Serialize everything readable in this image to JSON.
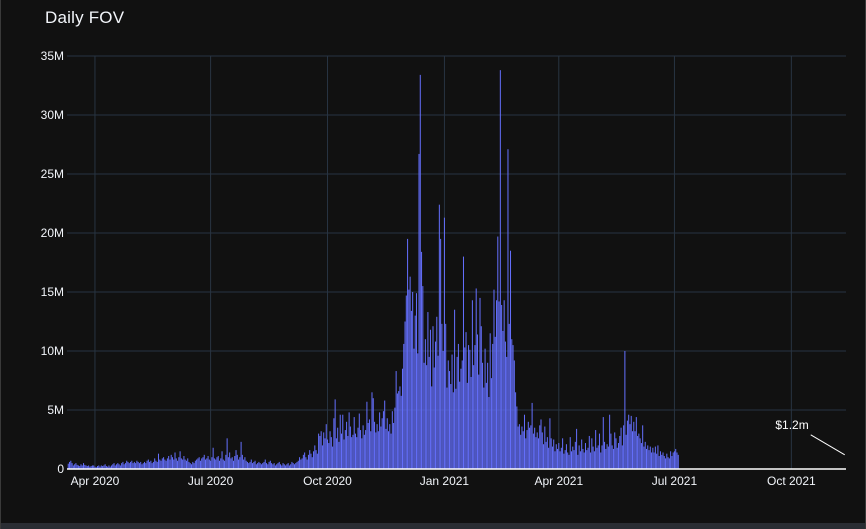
{
  "colors": {
    "background": "#111111",
    "grid": "#283442",
    "bar": "#636efa",
    "text": "#f2f5fa",
    "axis_line": "#ffffff"
  },
  "chart_data": {
    "type": "bar",
    "title": "Daily FOV",
    "xlabel": "",
    "ylabel": "",
    "grid": true,
    "x_range": [
      "2020-03-10",
      "2021-11-13"
    ],
    "ylim": [
      0,
      35000000
    ],
    "y_ticks": [
      0,
      5000000,
      10000000,
      15000000,
      20000000,
      25000000,
      30000000,
      35000000
    ],
    "y_tick_labels": [
      "0",
      "5M",
      "10M",
      "15M",
      "20M",
      "25M",
      "30M",
      "35M"
    ],
    "x_ticks": [
      "2020-04-01",
      "2020-07-01",
      "2020-10-01",
      "2021-01-01",
      "2021-04-01",
      "2021-07-01",
      "2021-10-01"
    ],
    "x_tick_labels": [
      "Apr 2020",
      "Jul 2020",
      "Oct 2020",
      "Jan 2021",
      "Apr 2021",
      "Jul 2021",
      "Oct 2021"
    ],
    "series": [
      {
        "color": "#636efa",
        "daily": true,
        "start_date": "2020-03-11",
        "values_m": [
          0.45,
          0.6,
          0.7,
          0.5,
          0.3,
          0.4,
          0.5,
          0.35,
          0.3,
          0.25,
          0.4,
          0.3,
          0.5,
          0.35,
          0.3,
          0.25,
          0.3,
          0.2,
          0.25,
          0.3,
          0.3,
          0.2,
          0.15,
          0.25,
          0.3,
          0.2,
          0.3,
          0.25,
          0.3,
          0.4,
          0.25,
          0.2,
          0.3,
          0.2,
          0.3,
          0.4,
          0.5,
          0.3,
          0.4,
          0.5,
          0.4,
          0.3,
          0.5,
          0.6,
          0.4,
          0.5,
          0.7,
          0.6,
          0.5,
          0.6,
          0.7,
          0.5,
          0.6,
          0.5,
          0.7,
          0.6,
          0.5,
          0.6,
          0.4,
          0.5,
          0.6,
          0.5,
          0.7,
          0.8,
          0.6,
          0.7,
          0.5,
          0.6,
          0.9,
          0.7,
          0.6,
          1.3,
          0.8,
          0.7,
          0.9,
          1.0,
          0.8,
          0.7,
          0.9,
          1.1,
          0.8,
          1.2,
          1.0,
          0.8,
          1.4,
          0.9,
          0.7,
          1.0,
          1.5,
          0.9,
          0.8,
          1.1,
          0.8,
          0.7,
          0.9,
          0.6,
          0.5,
          0.4,
          0.6,
          0.5,
          0.7,
          0.8,
          0.9,
          1.0,
          0.7,
          0.9,
          1.0,
          1.2,
          0.8,
          0.9,
          1.1,
          0.8,
          0.7,
          1.0,
          1.8,
          0.9,
          0.8,
          1.0,
          1.1,
          0.7,
          0.9,
          1.5,
          0.8,
          0.7,
          1.2,
          2.6,
          1.0,
          1.4,
          0.9,
          1.0,
          0.7,
          1.1,
          1.6,
          1.2,
          0.8,
          1.0,
          2.3,
          1.2,
          0.8,
          1.0,
          0.7,
          0.6,
          0.5,
          0.6,
          0.8,
          0.5,
          0.6,
          0.7,
          0.4,
          0.5,
          0.6,
          0.5,
          0.4,
          0.5,
          0.6,
          0.8,
          0.5,
          0.4,
          0.6,
          0.7,
          0.5,
          0.4,
          0.5,
          0.3,
          0.4,
          0.5,
          0.6,
          0.4,
          0.3,
          0.5,
          0.4,
          0.3,
          0.4,
          0.5,
          0.3,
          0.4,
          0.6,
          0.5,
          0.4,
          0.5,
          0.6,
          0.7,
          1.0,
          0.8,
          0.9,
          1.2,
          1.4,
          1.0,
          0.8,
          1.2,
          1.6,
          1.3,
          1.0,
          1.5,
          2.0,
          1.6,
          1.3,
          3.0,
          2.8,
          3.2,
          2.0,
          3.1,
          2.6,
          3.8,
          2.5,
          2.2,
          3.2,
          2.7,
          1.9,
          4.3,
          5.9,
          2.6,
          3.5,
          2.3,
          4.6,
          3.0,
          4.6,
          2.5,
          3.3,
          4.0,
          2.8,
          4.8,
          3.6,
          2.7,
          2.9,
          4.4,
          3.0,
          2.7,
          3.5,
          4.7,
          3.3,
          2.6,
          3.7,
          2.9,
          3.3,
          5.7,
          3.9,
          4.2,
          3.2,
          6.5,
          6.0,
          4.0,
          3.1,
          3.8,
          3.2,
          4.8,
          3.6,
          4.3,
          4.9,
          5.8,
          3.4,
          4.3,
          3.2,
          3.8,
          3.0,
          4.9,
          3.9,
          5.2,
          8.3,
          6.4,
          6.6,
          7.0,
          6.2,
          8.5,
          10.6,
          12.5,
          14.7,
          19.5,
          15.2,
          16.3,
          13.4,
          15.0,
          10.2,
          13.0,
          14.9,
          9.8,
          26.7,
          33.4,
          18.4,
          15.5,
          9.0,
          11.0,
          8.8,
          13.3,
          9.5,
          11.8,
          7.0,
          12.1,
          8.6,
          10.8,
          12.9,
          9.6,
          22.4,
          19.5,
          12.3,
          10.0,
          21.3,
          12.3,
          6.9,
          9.2,
          8.3,
          7.2,
          9.7,
          6.5,
          13.5,
          6.8,
          9.5,
          10.6,
          7.4,
          8.5,
          9.2,
          18.0,
          10.3,
          11.6,
          7.3,
          10.5,
          10.1,
          7.8,
          14.3,
          8.8,
          10.5,
          15.3,
          11.4,
          8.0,
          14.5,
          12.1,
          9.0,
          6.9,
          10.2,
          7.3,
          9.0,
          6.1,
          11.5,
          7.7,
          10.6,
          15.2,
          11.2,
          14.3,
          19.7,
          14.2,
          33.8,
          13.9,
          11.7,
          14.3,
          10.8,
          9.5,
          27.1,
          12.3,
          18.5,
          11.0,
          10.5,
          9.2,
          6.5,
          5.3,
          3.6,
          3.8,
          2.9,
          3.6,
          3.2,
          4.6,
          2.6,
          3.3,
          4.0,
          3.5,
          3.7,
          5.6,
          3.0,
          3.5,
          2.7,
          3.1,
          2.6,
          3.7,
          4.2,
          3.1,
          2.1,
          3.6,
          2.3,
          2.7,
          1.8,
          4.3,
          2.6,
          1.9,
          2.5,
          1.5,
          2.1,
          1.7,
          2.2,
          1.5,
          1.8,
          2.6,
          1.3,
          1.6,
          2.1,
          1.4,
          1.2,
          2.7,
          1.5,
          1.9,
          1.6,
          2.3,
          3.4,
          1.2,
          2.0,
          1.5,
          2.5,
          1.7,
          1.4,
          2.2,
          1.6,
          1.8,
          2.8,
          1.4,
          2.6,
          1.9,
          1.5,
          3.3,
          1.8,
          2.0,
          3.0,
          1.4,
          2.0,
          4.4,
          2.3,
          1.7,
          2.1,
          1.9,
          4.6,
          3.0,
          2.0,
          1.7,
          3.1,
          2.6,
          1.8,
          2.2,
          2.8,
          3.5,
          2.0,
          3.7,
          10.0,
          2.9,
          4.1,
          4.6,
          3.8,
          4.5,
          3.2,
          4.0,
          3.2,
          4.4,
          2.8,
          3.0,
          2.6,
          2.2,
          3.7,
          1.9,
          2.3,
          1.7,
          2.0,
          1.6,
          1.9,
          1.4,
          1.8,
          1.4,
          1.9,
          1.3,
          2.0,
          1.1,
          1.5,
          1.2,
          1.4,
          1.1,
          0.9,
          1.3,
          1.0,
          0.9,
          1.5,
          1.1,
          1.4,
          1.5,
          1.7,
          1.4,
          1.2
        ]
      }
    ],
    "annotation": {
      "text": "$1.2m",
      "date": "2021-11-12",
      "value": 1200000
    }
  }
}
